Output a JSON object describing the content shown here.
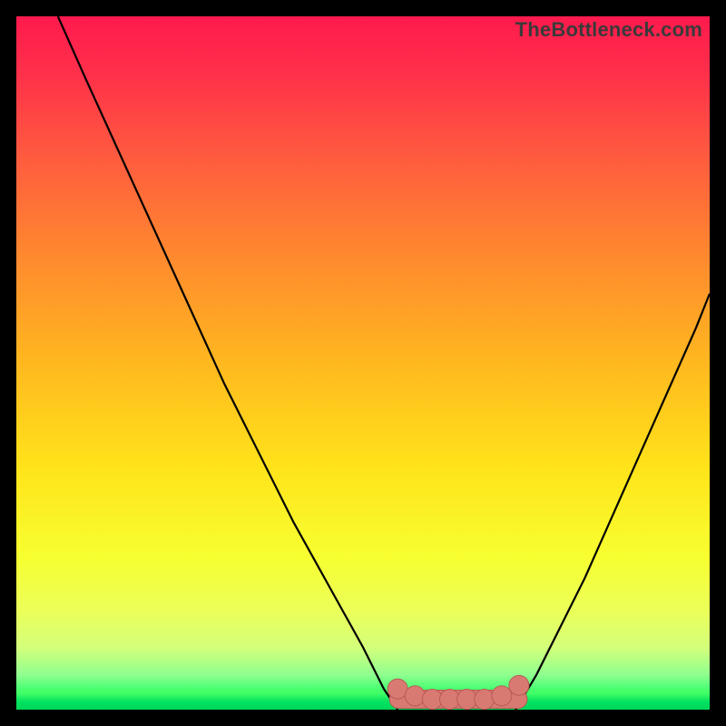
{
  "watermark": "TheBottleneck.com",
  "colors": {
    "frame": "#000000",
    "curve": "#000000",
    "marker": "#d97a72",
    "marker_border": "#b85a55"
  },
  "chart_data": {
    "type": "line",
    "title": "",
    "xlabel": "",
    "ylabel": "",
    "xlim": [
      0,
      100
    ],
    "ylim": [
      0,
      100
    ],
    "series": [
      {
        "name": "left-branch",
        "x": [
          6,
          10,
          15,
          20,
          25,
          30,
          35,
          40,
          45,
          50,
          53,
          55
        ],
        "y": [
          100,
          91,
          80,
          69,
          58,
          47,
          37,
          27,
          18,
          9,
          3,
          0
        ]
      },
      {
        "name": "right-branch",
        "x": [
          72,
          75,
          78,
          82,
          86,
          90,
          94,
          98,
          100
        ],
        "y": [
          0,
          5,
          11,
          19,
          28,
          37,
          46,
          55,
          60
        ]
      },
      {
        "name": "bottom-markers",
        "x": [
          55,
          57.5,
          60,
          62.5,
          65,
          67.5,
          70,
          72.5
        ],
        "y": [
          3,
          2,
          1.5,
          1.5,
          1.5,
          1.5,
          2,
          3.5
        ]
      }
    ],
    "background_gradient": [
      {
        "stop": 0.0,
        "color": "#ff1a4d"
      },
      {
        "stop": 0.5,
        "color": "#ffb81f"
      },
      {
        "stop": 0.8,
        "color": "#f7ff30"
      },
      {
        "stop": 0.95,
        "color": "#8fff8f"
      },
      {
        "stop": 1.0,
        "color": "#00e65a"
      }
    ]
  }
}
